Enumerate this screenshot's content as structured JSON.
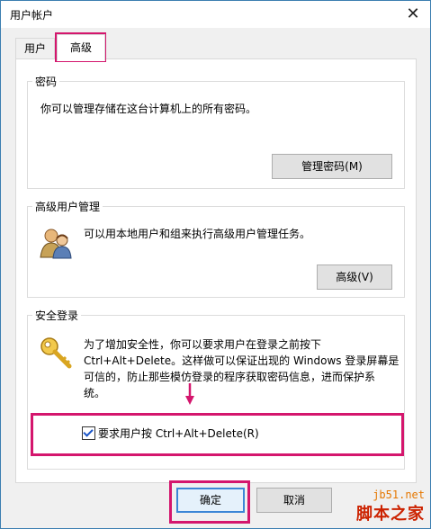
{
  "window": {
    "title": "用户帐户",
    "close_symbol": "✕"
  },
  "tabs": [
    {
      "label": "用户"
    },
    {
      "label": "高级"
    }
  ],
  "password_group": {
    "legend": "密码",
    "description": "你可以管理存储在这台计算机上的所有密码。",
    "button": "管理密码(M)"
  },
  "advanced_group": {
    "legend": "高级用户管理",
    "description": "可以用本地用户和组来执行高级用户管理任务。",
    "button": "高级(V)",
    "icon": "users-icon"
  },
  "secure_group": {
    "legend": "安全登录",
    "lines": [
      "为了增加安全性，你可以要求用户在登录之前按下",
      "Ctrl+Alt+Delete。这样做可以保证出现的 Windows 登录屏幕是",
      "可信的，防止那些模仿登录的程序获取密码信息，进而保护系",
      "统。"
    ],
    "checkbox_label": "要求用户按 Ctrl+Alt+Delete(R)",
    "checkbox_checked": true,
    "icon": "key-icon"
  },
  "footer": {
    "ok": "确定",
    "cancel": "取消"
  },
  "watermark": {
    "site": "jb51.net",
    "name": "脚本之家"
  },
  "annotation_color": "#d4166d"
}
